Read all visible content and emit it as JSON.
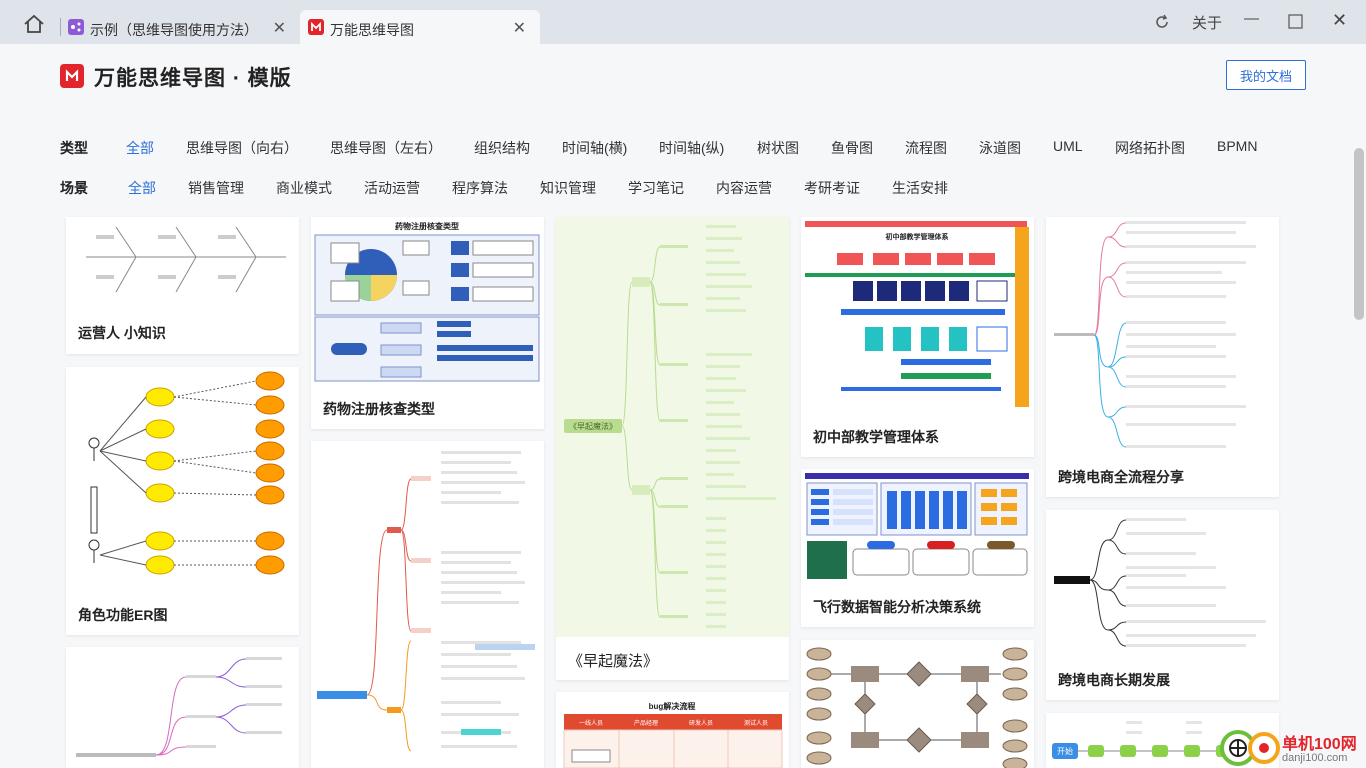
{
  "tabs": [
    {
      "title": "示例（思维导图使用方法）",
      "active": false
    },
    {
      "title": "万能思维导图",
      "active": true
    }
  ],
  "window": {
    "about": "关于"
  },
  "header": {
    "title": "万能思维导图 · 模版",
    "my_docs": "我的文档"
  },
  "filters": {
    "type_label": "类型",
    "types": [
      "全部",
      "思维导图（向右）",
      "思维导图（左右）",
      "组织结构",
      "时间轴(横)",
      "时间轴(纵)",
      "树状图",
      "鱼骨图",
      "流程图",
      "泳道图",
      "UML",
      "网络拓扑图",
      "BPMN"
    ],
    "scene_label": "场景",
    "scenes": [
      "全部",
      "销售管理",
      "商业模式",
      "活动运营",
      "程序算法",
      "知识管理",
      "学习笔记",
      "内容运营",
      "考研考证",
      "生活安排"
    ],
    "selected_type": "全部",
    "selected_scene": "全部"
  },
  "cards": {
    "c1": "运营人 小知识",
    "c2": "角色功能ER图",
    "c4": "药物注册核查类型",
    "c6": "《早起魔法》",
    "c7": "bug解决流程",
    "c8": "初中部教学管理体系",
    "c9": "飞行数据智能分析决策系统",
    "c11": "跨境电商全流程分享",
    "c12": "跨境电商长期发展"
  },
  "thumb_text": {
    "drug_title": "药物注册核查类型",
    "bug_title": "bug解决流程",
    "bug_cols": [
      "一线人员",
      "产品经理",
      "研发人员",
      "测试人员"
    ],
    "school_title": "初中部教学管理体系",
    "flow_start": "开始",
    "magic_center": "《早起魔法》"
  },
  "watermark": {
    "site": "单机100网",
    "url": "danji100.com"
  },
  "colors": {
    "accent": "#2e6fd9",
    "brand": "#e1252b"
  }
}
